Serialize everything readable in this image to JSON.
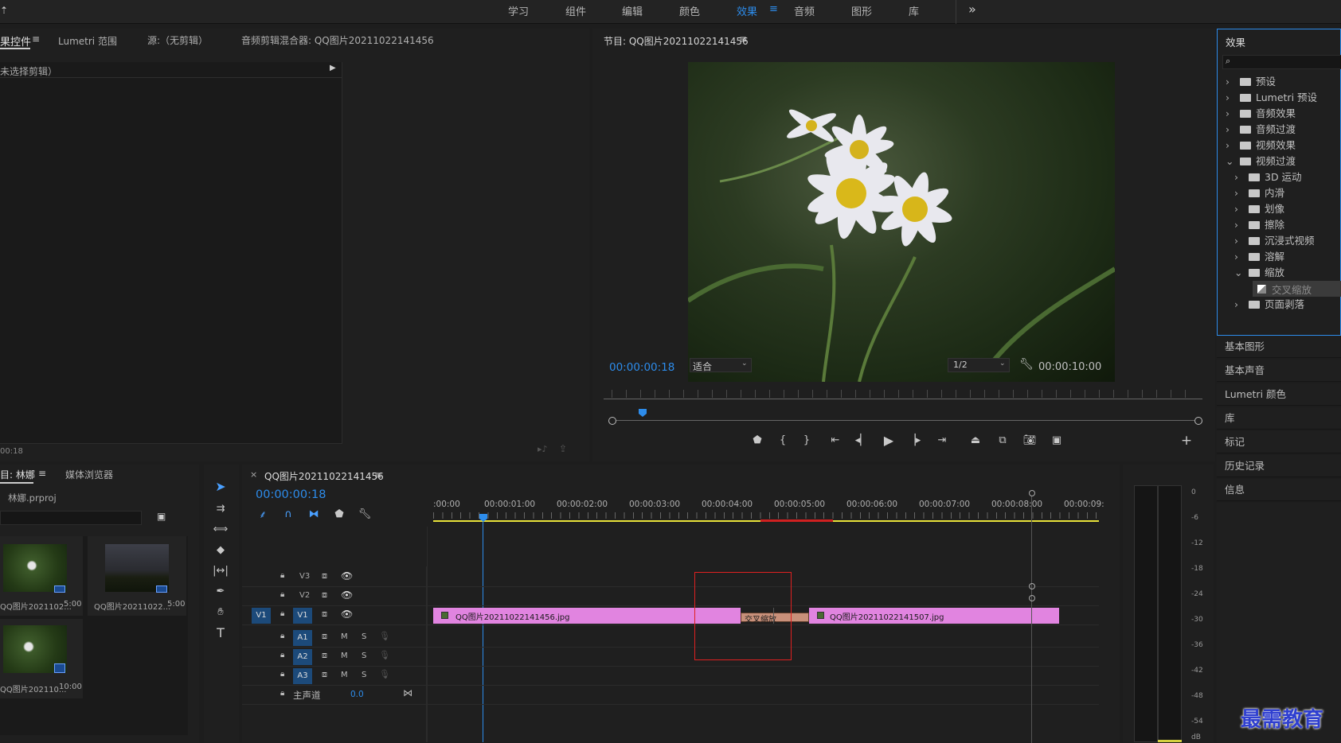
{
  "workspaces": {
    "items": [
      "学习",
      "组件",
      "编辑",
      "颜色",
      "效果",
      "音频",
      "图形",
      "库"
    ],
    "active": "效果",
    "more": "»"
  },
  "source_panel": {
    "tabs": [
      "果控件",
      "Lumetri 范围",
      "源:（无剪辑）",
      "音频剪辑混合器: QQ图片20211022141456"
    ],
    "no_clip": "未选择剪辑）",
    "timecode": "00:18"
  },
  "program": {
    "title": "节目: QQ图片20211022141456",
    "timecode": "00:00:00:18",
    "fit": "适合",
    "resolution": "1/2",
    "duration": "00:00:10:00"
  },
  "effects": {
    "title": "效果",
    "search_placeholder": "",
    "tree": [
      {
        "label": "预设",
        "level": 0,
        "open": false
      },
      {
        "label": "Lumetri 预设",
        "level": 0,
        "open": false
      },
      {
        "label": "音频效果",
        "level": 0,
        "open": false
      },
      {
        "label": "音频过渡",
        "level": 0,
        "open": false
      },
      {
        "label": "视频效果",
        "level": 0,
        "open": false
      },
      {
        "label": "视频过渡",
        "level": 0,
        "open": true
      },
      {
        "label": "3D 运动",
        "level": 1,
        "open": false
      },
      {
        "label": "内滑",
        "level": 1,
        "open": false
      },
      {
        "label": "划像",
        "level": 1,
        "open": false
      },
      {
        "label": "擦除",
        "level": 1,
        "open": false
      },
      {
        "label": "沉浸式视频",
        "level": 1,
        "open": false
      },
      {
        "label": "溶解",
        "level": 1,
        "open": false
      },
      {
        "label": "缩放",
        "level": 1,
        "open": true
      },
      {
        "label": "交叉缩放",
        "level": 2,
        "selected": true
      },
      {
        "label": "页面剥落",
        "level": 1,
        "open": false
      }
    ]
  },
  "side_panels": [
    "基本图形",
    "基本声音",
    "Lumetri 颜色",
    "库",
    "标记",
    "历史记录",
    "信息"
  ],
  "project": {
    "tabs": [
      "目: 林娜",
      "媒体浏览器"
    ],
    "file": "林娜.prproj",
    "items": [
      {
        "name": "QQ图片2021102...",
        "duration": "5:00"
      },
      {
        "name": "QQ图片20211022...",
        "duration": "5:00"
      },
      {
        "name": "QQ图片202110...",
        "duration": "10:00"
      }
    ]
  },
  "timeline": {
    "title": "QQ图片20211022141456",
    "close": "×",
    "timecode": "00:00:00:18",
    "ruler": [
      ":00:00",
      "00:00:01:00",
      "00:00:02:00",
      "00:00:03:00",
      "00:00:04:00",
      "00:00:05:00",
      "00:00:06:00",
      "00:00:07:00",
      "00:00:08:00",
      "00:00:09:"
    ],
    "video_tracks": [
      "V3",
      "V2",
      "V1"
    ],
    "source_patch": "V1",
    "audio_tracks": [
      "A1",
      "A2",
      "A3"
    ],
    "master_label": "主声道",
    "master_value": "0.0",
    "clip_a": "QQ图片20211022141456.jpg",
    "clip_b": "QQ图片20211022141507.jpg",
    "transition": "交叉缩放",
    "m_label": "M",
    "s_label": "S"
  },
  "meter": {
    "labels": [
      "0",
      "-6",
      "-12",
      "-18",
      "-24",
      "-30",
      "-36",
      "-42",
      "-48",
      "-54",
      "dB"
    ]
  },
  "watermark": "最需教育",
  "colors": {
    "accent": "#2d8ceb",
    "clip": "#e184e0",
    "transition": "#c8907a",
    "highlight_box": "#e02020"
  }
}
